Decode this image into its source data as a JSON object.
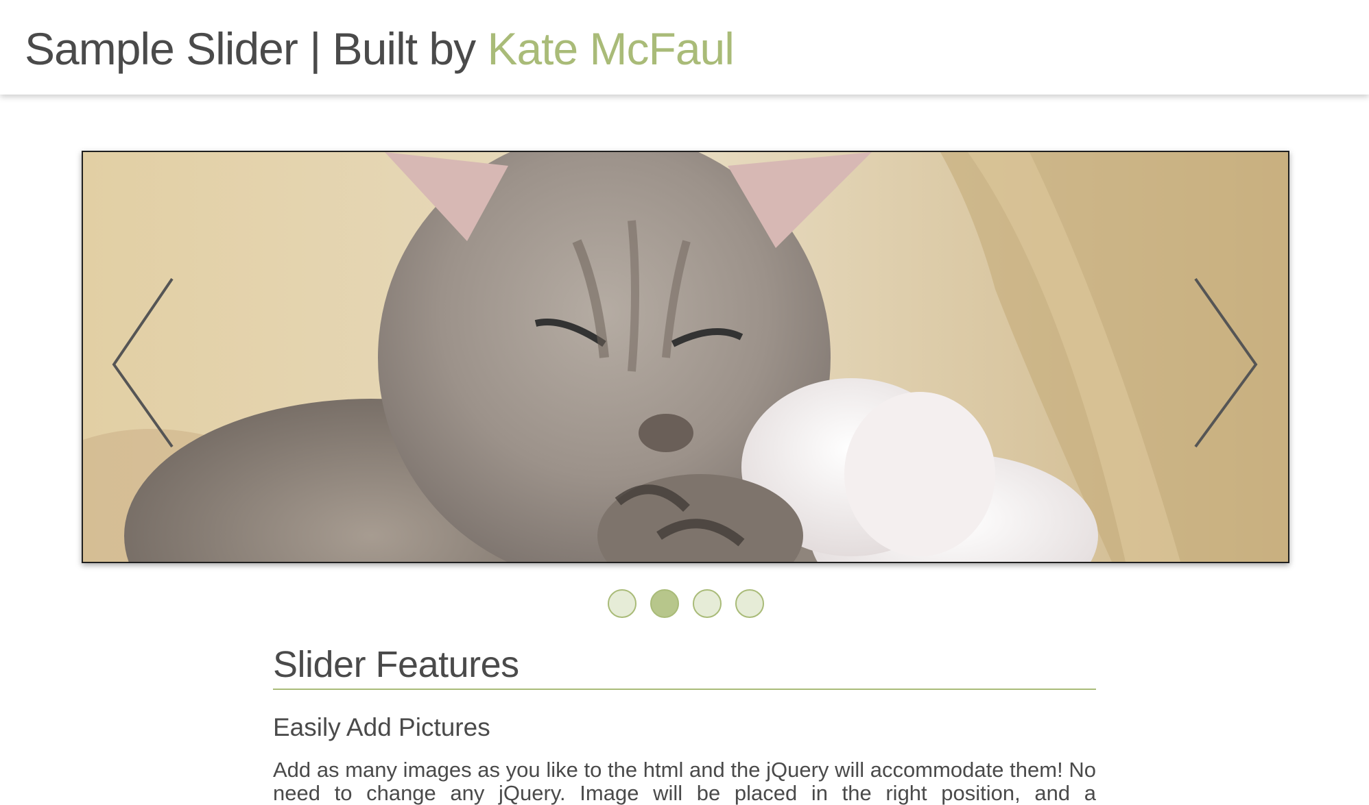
{
  "header": {
    "title_prefix": "Sample Slider | Built by ",
    "author": "Kate McFaul",
    "accent_color": "#a9bb78"
  },
  "slider": {
    "image_alt": "kittens",
    "prev_icon": "chevron-left-icon",
    "next_icon": "chevron-right-icon",
    "dots_count": 4,
    "active_dot_index": 1
  },
  "content": {
    "section_title": "Slider Features",
    "features": [
      {
        "title": "Easily Add Pictures",
        "text": "Add as many images as you like to the html and the jQuery will accommodate them! No need to change any jQuery. Image will be placed in the right position, and a"
      }
    ]
  }
}
